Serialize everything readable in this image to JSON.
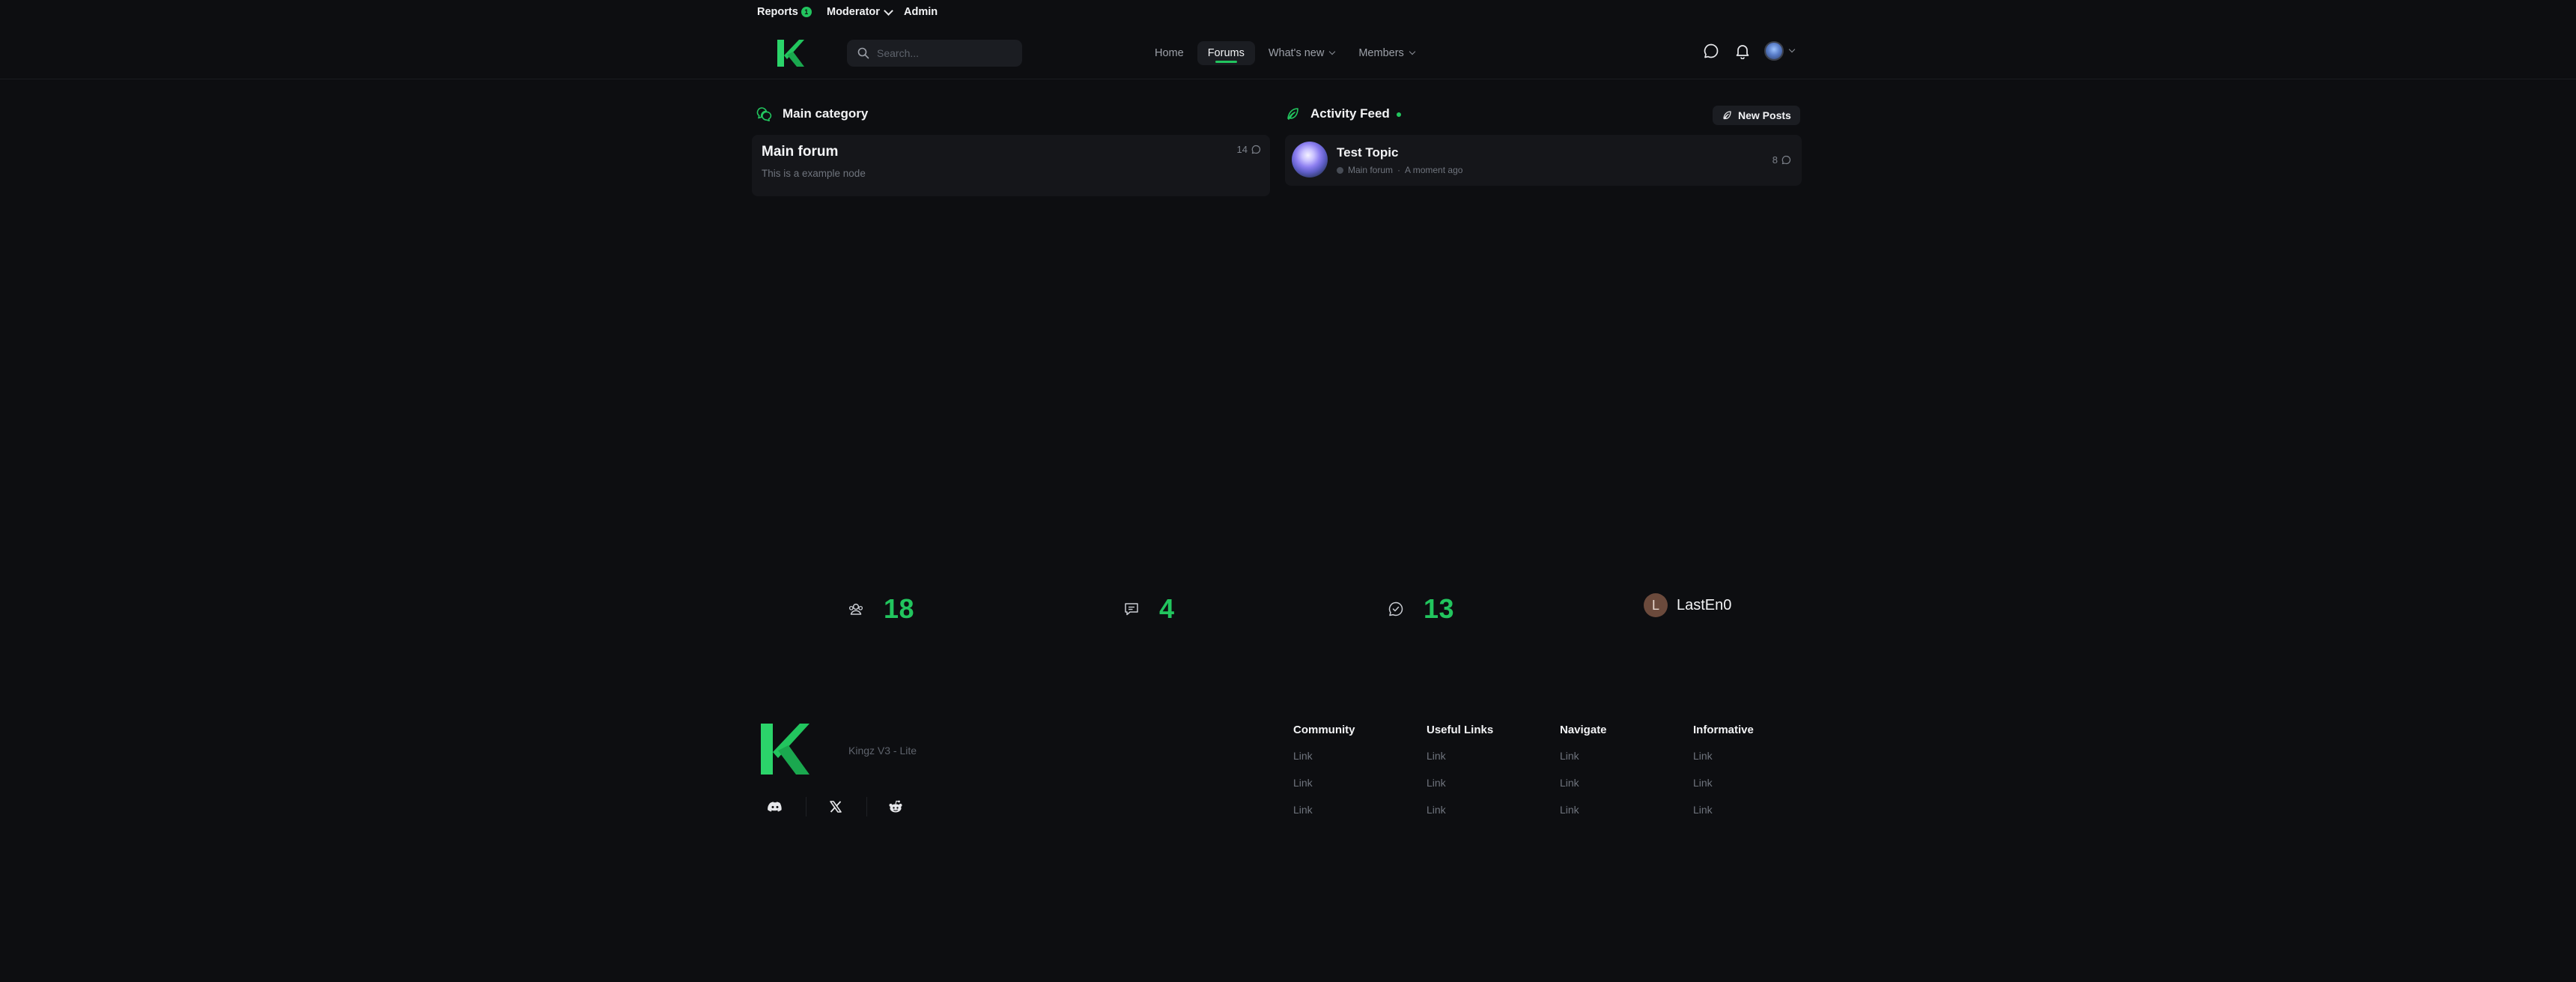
{
  "staff": {
    "reports_label": "Reports",
    "reports_count": "1",
    "moderator_label": "Moderator",
    "admin_label": "Admin"
  },
  "search": {
    "placeholder": "Search..."
  },
  "nav": {
    "home": "Home",
    "forums": "Forums",
    "whats_new": "What's new",
    "members": "Members",
    "active": "Forums"
  },
  "category": {
    "title": "Main category",
    "forum": {
      "title": "Main forum",
      "description": "This is a example node",
      "count": "14"
    }
  },
  "activity": {
    "title": "Activity Feed",
    "new_posts_label": "New Posts",
    "topic": {
      "title": "Test Topic",
      "forum": "Main forum",
      "separator": "·",
      "time": "A moment ago",
      "count": "8"
    }
  },
  "stats": {
    "members": "18",
    "threads": "4",
    "messages": "13",
    "latest_member": "LastEn0",
    "latest_member_initial": "L"
  },
  "footer": {
    "site_name": "Kingz V3 - Lite",
    "columns": [
      {
        "heading": "Community",
        "links": [
          "Link",
          "Link",
          "Link"
        ]
      },
      {
        "heading": "Useful Links",
        "links": [
          "Link",
          "Link",
          "Link"
        ]
      },
      {
        "heading": "Navigate",
        "links": [
          "Link",
          "Link",
          "Link"
        ]
      },
      {
        "heading": "Informative",
        "links": [
          "Link",
          "Link",
          "Link"
        ]
      }
    ]
  },
  "colors": {
    "accent": "#22c55e",
    "background": "#0d0e11",
    "card": "#15161a"
  },
  "icons": {
    "logo": "kingz-logo-icon",
    "search": "search-icon",
    "chat": "chat-icon",
    "bell": "bell-icon",
    "category": "comments-icon",
    "activity": "feather-icon",
    "members": "users-icon",
    "threads": "message-icon",
    "messages": "comment-check-icon",
    "discord": "discord-icon",
    "x": "x-icon",
    "reddit": "reddit-icon"
  }
}
